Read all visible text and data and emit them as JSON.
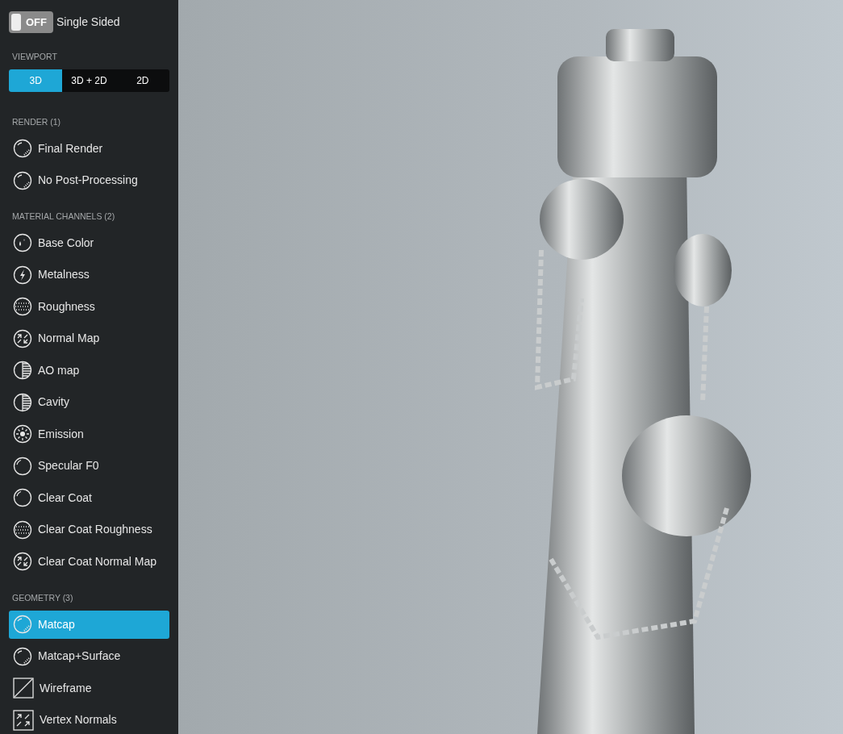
{
  "single_sided": {
    "on": false,
    "state_text": "OFF",
    "label": "Single Sided"
  },
  "viewport": {
    "header": "VIEWPORT",
    "options": [
      {
        "label": "3D",
        "selected": true
      },
      {
        "label": "3D + 2D",
        "selected": false
      },
      {
        "label": "2D",
        "selected": false
      }
    ]
  },
  "sections": [
    {
      "header": "RENDER (1)",
      "items": [
        {
          "label": "Final Render",
          "kind": "sphere",
          "selected": false
        },
        {
          "label": "No Post-Processing",
          "kind": "sphere",
          "selected": false
        }
      ]
    },
    {
      "header": "MATERIAL CHANNELS (2)",
      "items": [
        {
          "label": "Base Color",
          "kind": "drops",
          "selected": false
        },
        {
          "label": "Metalness",
          "kind": "bolt",
          "selected": false
        },
        {
          "label": "Roughness",
          "kind": "dots",
          "selected": false
        },
        {
          "label": "Normal Map",
          "kind": "arrows",
          "selected": false
        },
        {
          "label": "AO map",
          "kind": "stripes",
          "selected": false
        },
        {
          "label": "Cavity",
          "kind": "stripes",
          "selected": false
        },
        {
          "label": "Emission",
          "kind": "sun",
          "selected": false
        },
        {
          "label": "Specular F0",
          "kind": "gloss",
          "selected": false
        },
        {
          "label": "Clear Coat",
          "kind": "gloss",
          "selected": false
        },
        {
          "label": "Clear Coat Roughness",
          "kind": "dots",
          "selected": false
        },
        {
          "label": "Clear Coat Normal Map",
          "kind": "arrows",
          "selected": false
        }
      ]
    },
    {
      "header": "GEOMETRY (3)",
      "items": [
        {
          "label": "Matcap",
          "kind": "sphere",
          "selected": true
        },
        {
          "label": "Matcap+Surface",
          "kind": "sphere",
          "selected": false
        },
        {
          "label": "Wireframe",
          "kind": "diagonal",
          "selected": false
        },
        {
          "label": "Vertex Normals",
          "kind": "squarearrows",
          "selected": false
        }
      ]
    }
  ]
}
